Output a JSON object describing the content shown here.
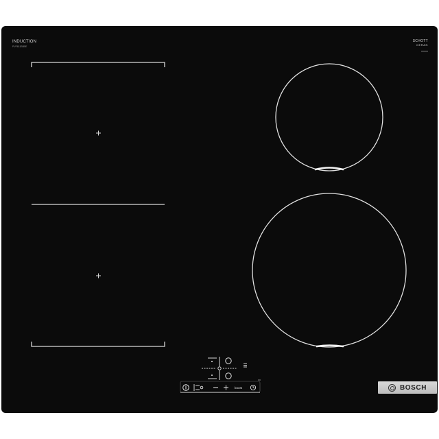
{
  "hob": {
    "type_label": "INDUCTION",
    "model_number": "PVF611BB5E",
    "glass_brand": "SCHOTT",
    "glass_type": "CERAN",
    "brand_name": "BOSCH"
  },
  "zones": [
    {
      "name": "flex-zone-front-left",
      "shape": "flex-rectangle"
    },
    {
      "name": "flex-zone-rear-left",
      "shape": "flex-rectangle"
    },
    {
      "name": "zone-rear-right",
      "shape": "circle"
    },
    {
      "name": "zone-front-right",
      "shape": "circle"
    }
  ],
  "controls": {
    "power_symbol": "⏻",
    "childlock_symbol": "⊶",
    "minus_symbol": "−",
    "plus_symbol": "+",
    "boost_symbol": "boost",
    "timer_symbol": "◷",
    "combine_symbol": "≡"
  },
  "colors": {
    "glass": "#0b0b0b",
    "markings": "#d8d8d8",
    "badge": "#cfcfcf"
  }
}
